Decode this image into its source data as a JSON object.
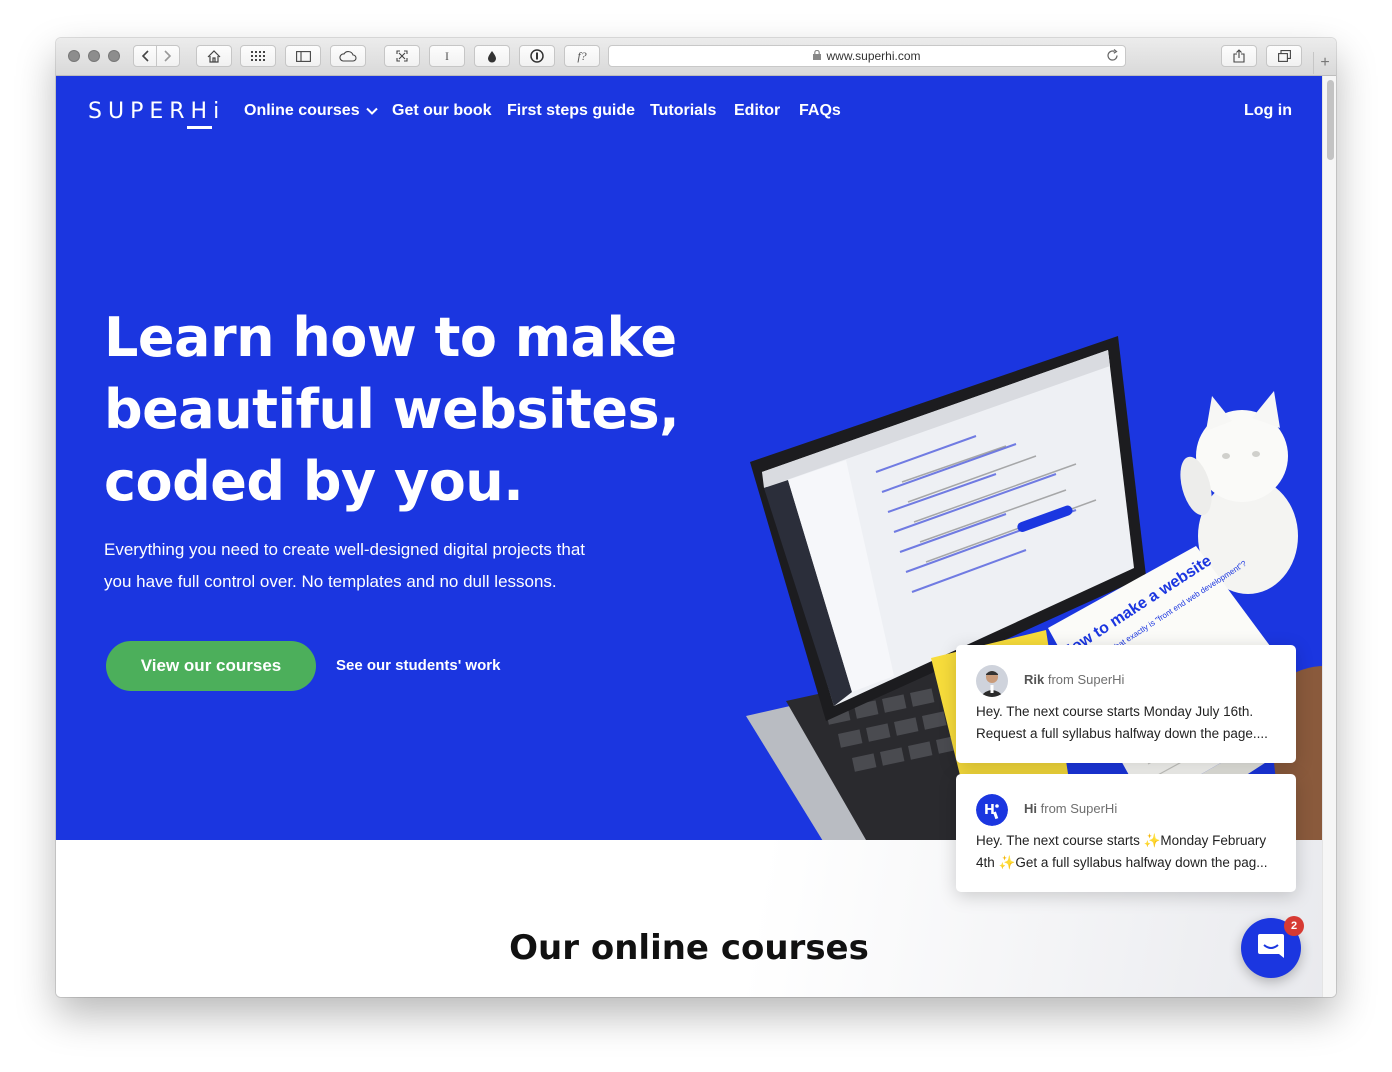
{
  "browser": {
    "url": "www.superhi.com",
    "bookmark_buttons": [
      "I",
      "f?"
    ]
  },
  "nav": {
    "logo": "SUPERHi",
    "items": [
      {
        "label": "Online courses"
      },
      {
        "label": "Get our book"
      },
      {
        "label": "First steps guide"
      },
      {
        "label": "Tutorials"
      },
      {
        "label": "Editor"
      },
      {
        "label": "FAQs"
      }
    ],
    "login": "Log in"
  },
  "hero": {
    "headline_lines": [
      "Learn how to make",
      "beautiful websites,",
      "coded by you."
    ],
    "subcopy_lines": [
      "Everything you need to create well-designed digital projects that",
      "you have full control over. No templates and no dull lessons."
    ],
    "cta": "View our courses",
    "secondary_link": "See our students' work",
    "book_title": "How to make a website",
    "book_subtitle": "...and what exactly is \"front end web development\"?"
  },
  "section": {
    "title": "Our online courses"
  },
  "chat": {
    "messages": [
      {
        "sender": "Rik",
        "from_suffix": "from SuperHi",
        "lines": [
          "Hey. The next course starts Monday July 16th.",
          "Request a full syllabus halfway down the page...."
        ]
      },
      {
        "sender": "Hi",
        "from_suffix": "from SuperHi",
        "lines": [
          "Hey. The next course starts ✨Monday February",
          "4th ✨Get a full syllabus halfway down the pag..."
        ]
      }
    ],
    "unread_count": "2"
  },
  "colors": {
    "brand_blue": "#1b36e0",
    "cta_green": "#4caf5b",
    "badge_red": "#d73a33"
  },
  "icons": [
    "back-icon",
    "forward-icon",
    "home-icon",
    "grid-icon",
    "sidebar-icon",
    "cloud-icon",
    "expand-icon",
    "drop-icon",
    "password-icon",
    "lock-icon",
    "reload-icon",
    "share-icon",
    "tabs-icon",
    "chevron-down-icon",
    "chat-icon"
  ]
}
